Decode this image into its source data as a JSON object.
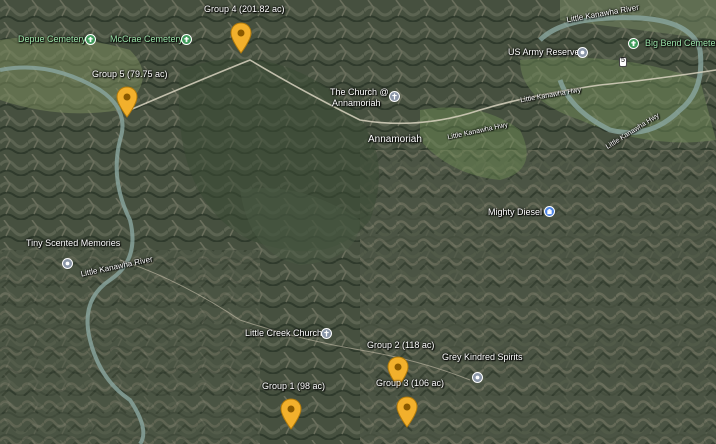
{
  "map": {
    "places": {
      "depue_cemetery": "Depue Cemetery",
      "mccrae_cemetery": "McCrae Cemetery",
      "church_annamoriah_line1": "The Church @",
      "church_annamoriah_line2": "Annamoriah",
      "annamoriah": "Annamoriah",
      "us_army_reserve": "US Army Reserve",
      "big_bend_cemetery": "Big Bend Cemetery",
      "mighty_diesel": "Mighty Diesel",
      "tiny_scented_memories": "Tiny Scented Memories",
      "little_creek_church": "Little Creek Church",
      "grey_kindred_spirits": "Grey Kindred Spirits"
    },
    "rivers": {
      "little_kanawha_top": "Little Kanawha River",
      "little_kanawha_left": "Little Kanawha River"
    },
    "roads": {
      "little_kanawha_hwy_a": "Little Kanawha Hwy",
      "little_kanawha_hwy_b": "Little Kanawha Hwy",
      "little_kanawha_hwy_c": "Little Kanawha Hwy",
      "route_shield": "5"
    },
    "groups": {
      "group4": "Group 4 (201.82 ac)",
      "group5": "Group 5 (79.75 ac)",
      "group2": "Group 2 (118 ac)",
      "group3": "Group 3 (106 ac)",
      "group1": "Group 1 (98 ac)"
    },
    "colors": {
      "pin": "#f2b02c",
      "pin_dot": "#8a5a00",
      "river": "#8aa6a0",
      "green_label": "#9be3a9"
    },
    "icons": {
      "cemetery": "cemetery-icon",
      "church": "church-icon",
      "store": "store-icon",
      "place": "place-icon",
      "pin": "location-pin-icon"
    }
  }
}
